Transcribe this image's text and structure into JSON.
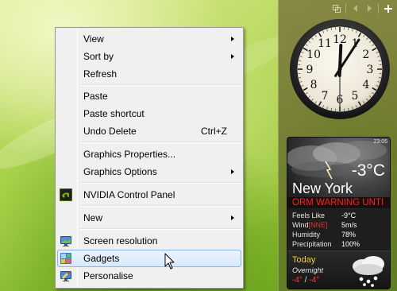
{
  "colors": {
    "menu_bg": "#f0f0f0",
    "menu_highlight": "#d9e9fb",
    "menu_highlight_border": "#8bb3e3",
    "weather_warning": "#ff2020",
    "weather_today": "#f2c94c",
    "weather_range": "#ff3b3b"
  },
  "context_menu": {
    "items": [
      {
        "label": "View",
        "submenu": true
      },
      {
        "label": "Sort by",
        "submenu": true
      },
      {
        "label": "Refresh"
      },
      {
        "label": "Paste"
      },
      {
        "label": "Paste shortcut"
      },
      {
        "label": "Undo Delete",
        "shortcut": "Ctrl+Z"
      },
      {
        "label": "Graphics Properties..."
      },
      {
        "label": "Graphics Options",
        "submenu": true
      },
      {
        "label": "NVIDIA Control Panel",
        "icon": "nvidia-icon"
      },
      {
        "label": "New",
        "submenu": true
      },
      {
        "label": "Screen resolution",
        "icon": "monitor-icon"
      },
      {
        "label": "Gadgets",
        "icon": "gadgets-icon",
        "highlighted": true
      },
      {
        "label": "Personalise",
        "icon": "personalise-icon"
      }
    ]
  },
  "sidebar": {
    "controls": [
      "copy-icon",
      "previous-icon",
      "next-icon",
      "add-icon"
    ],
    "clock": {
      "numerals": [
        "12",
        "1",
        "2",
        "3",
        "4",
        "5",
        "6",
        "7",
        "8",
        "9",
        "10",
        "11"
      ],
      "hour": 12,
      "minute": 5,
      "second": 30
    }
  },
  "weather": {
    "time": "23:05",
    "temperature": "-3°C",
    "city": "New York",
    "warning": "ORM WARNING UNTI",
    "details": [
      {
        "label": "Feels Like",
        "value": "-9°C"
      },
      {
        "label": "Wind",
        "direction": "[NNE]",
        "value": "5m/s"
      },
      {
        "label": "Humidity",
        "value": "78%"
      },
      {
        "label": "Precipitation",
        "value": "100%"
      }
    ],
    "forecast": {
      "day": "Today",
      "period": "Overnight",
      "high": "-4°",
      "separator": " / ",
      "low": "-4°",
      "icon": "snow-cloud-icon"
    }
  }
}
